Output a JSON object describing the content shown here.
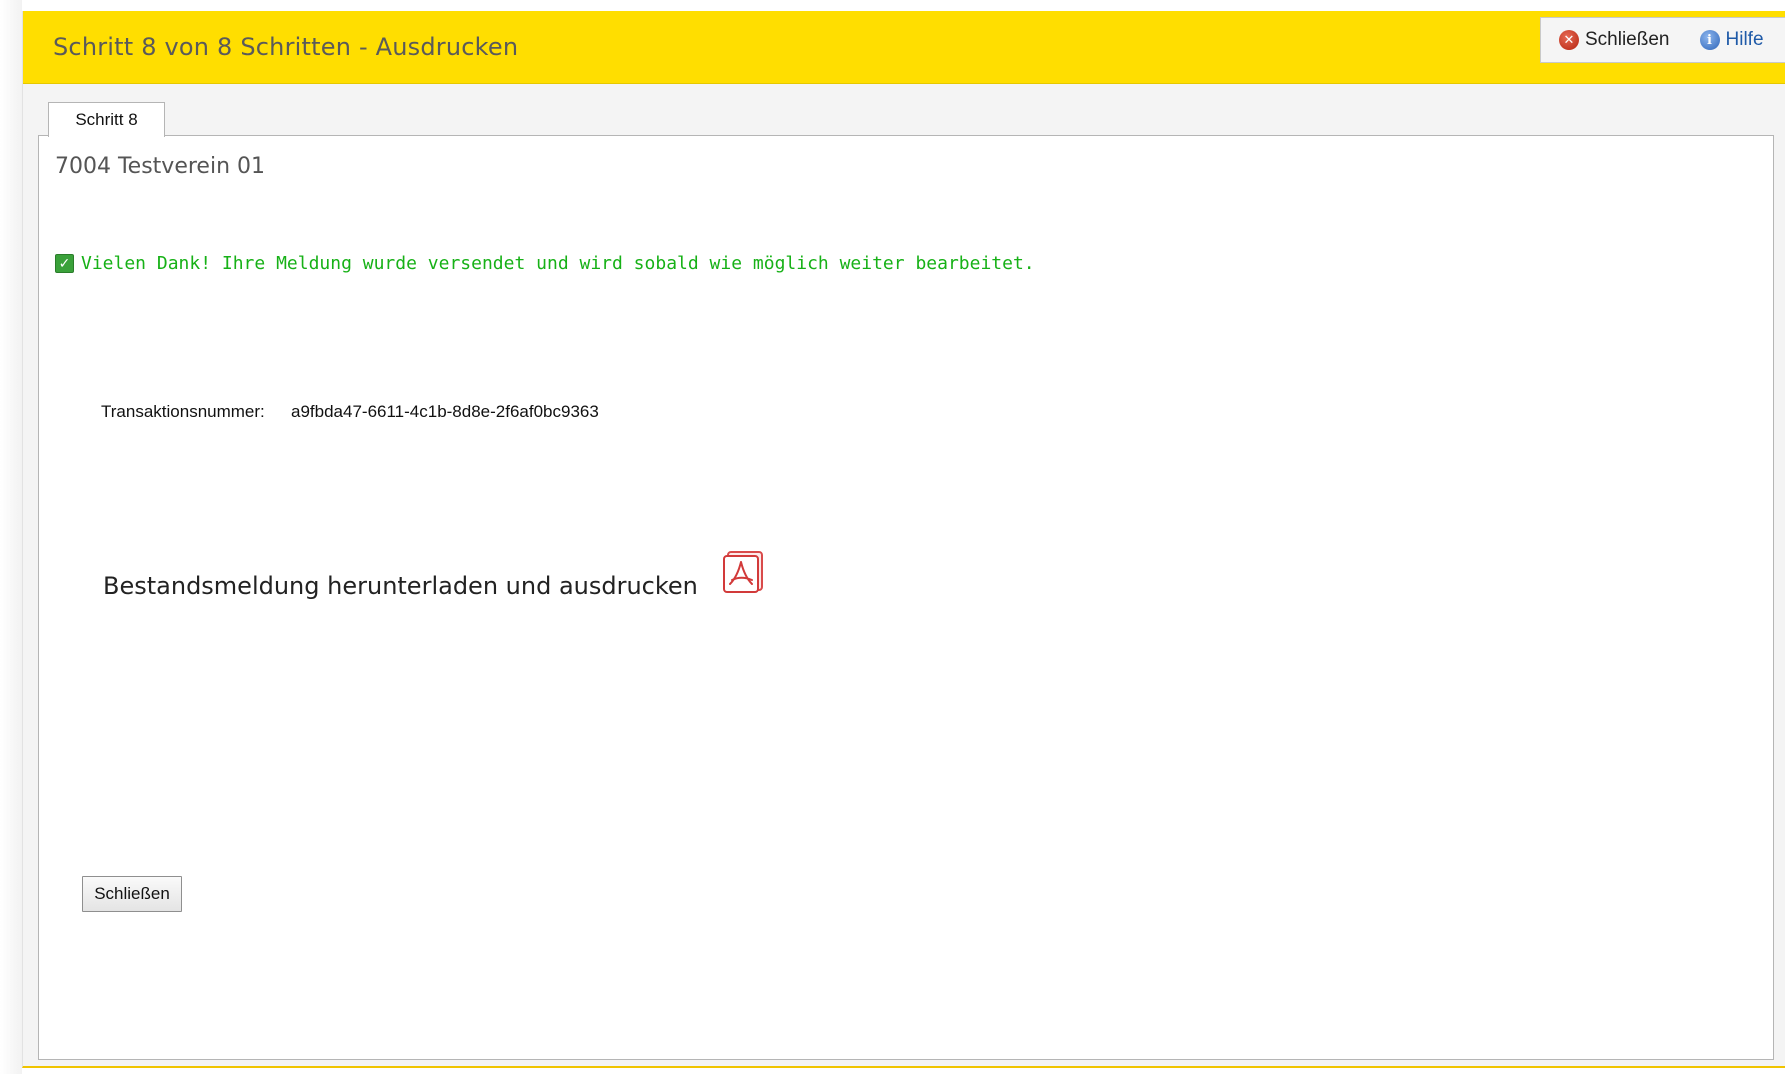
{
  "window": {
    "title": "Schritt 8 von 8 Schritten - Ausdrucken",
    "actions": {
      "close_label": "Schließen",
      "help_label": "Hilfe"
    }
  },
  "tabs": [
    {
      "label": "Schritt 8",
      "active": true
    }
  ],
  "content": {
    "organization": "7004 Testverein 01",
    "success_message": "Vielen Dank! Ihre Meldung wurde versendet und wird sobald wie möglich weiter bearbeitet.",
    "transaction": {
      "label": "Transaktionsnummer:",
      "value": "a9fbda47-6611-4c1b-8d8e-2f6af0bc9363"
    },
    "download_label": "Bestandsmeldung herunterladen und ausdrucken",
    "close_button_label": "Schließen"
  },
  "icons": {
    "close": "close-icon",
    "help": "info-icon",
    "success": "checkbox-checked-icon",
    "download": "pdf-icon"
  },
  "colors": {
    "titlebar": "#ffde00",
    "success_text": "#17b117",
    "help_link": "#1f5aa8"
  }
}
